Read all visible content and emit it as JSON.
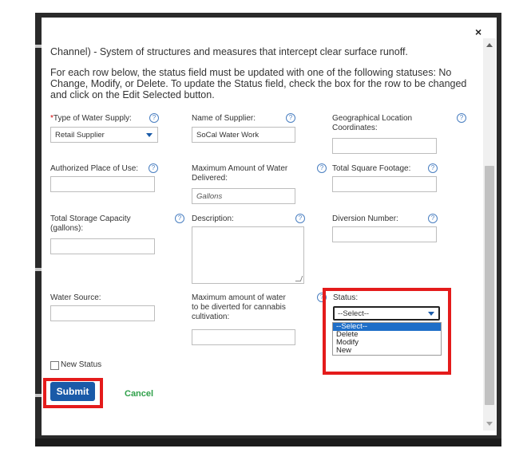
{
  "dialog": {
    "intro_text": "Channel) - System of structures and measures that intercept clear surface runoff.",
    "instruction_text": "For each row below, the status field must be updated with one of the following statuses: No Change, Modify, or Delete. To update the Status field, check the box for the row to be changed and click on the Edit Selected button."
  },
  "form": {
    "type_of_water_supply": {
      "label": "Type of Water Supply:",
      "value": "Retail Supplier"
    },
    "name_of_supplier": {
      "label": "Name of Supplier:",
      "value": "SoCal Water Work"
    },
    "geo_location": {
      "label": "Geographical Location Coordinates:",
      "value": ""
    },
    "authorized_place": {
      "label": "Authorized Place of Use:",
      "value": ""
    },
    "max_amount_delivered": {
      "label": "Maximum Amount of Water Delivered:",
      "placeholder": "Gallons"
    },
    "total_square_footage": {
      "label": "Total Square Footage:",
      "value": ""
    },
    "total_storage_capacity": {
      "label": "Total Storage Capacity (gallons):",
      "value": ""
    },
    "description": {
      "label": "Description:",
      "value": ""
    },
    "diversion_number": {
      "label": "Diversion Number:",
      "value": ""
    },
    "water_source": {
      "label": "Water Source:",
      "value": ""
    },
    "max_amount_cannabis": {
      "label": "Maximum amount of water to be diverted for cannabis cultivation:",
      "value": ""
    },
    "status": {
      "label": "Status:",
      "selected": "--Select--",
      "options": [
        "--Select--",
        "Delete",
        "Modify",
        "New"
      ]
    },
    "new_status_label": "New Status"
  },
  "actions": {
    "submit_label": "Submit",
    "cancel_label": "Cancel",
    "close_glyph": "×"
  },
  "colors": {
    "accent": "#1a5aa8",
    "highlight": "#e41b1b",
    "cancel": "#2fa04a"
  }
}
